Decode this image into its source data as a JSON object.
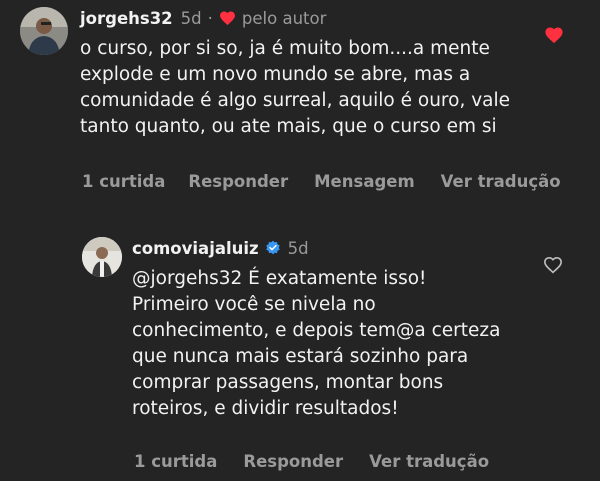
{
  "comment": {
    "username": "jorgehs32",
    "time": "5d",
    "liked_by_author": "pelo autor",
    "text": "o curso, por si so, ja é muito bom....a mente explode e um novo mundo se abre, mas a comunidade é algo surreal, aquilo é ouro, vale tanto quanto, ou ate mais, que o curso em si",
    "actions": {
      "likes": "1 curtida",
      "reply": "Responder",
      "message": "Mensagem",
      "translate": "Ver tradução"
    },
    "liked": true
  },
  "reply": {
    "username": "comoviajaluiz",
    "verified": true,
    "time": "5d",
    "text": "@jorgehs32 É exatamente isso! Primeiro você se nivela no conhecimento, e depois tem@a certeza que nunca mais estará sozinho para comprar passagens, montar bons roteiros, e dividir resultados!",
    "actions": {
      "likes": "1 curtida",
      "reply": "Responder",
      "translate": "Ver tradução"
    },
    "liked": false
  },
  "colors": {
    "background": "#242424",
    "heart": "#ff3040",
    "verified": "#3897f0",
    "muted": "#9a9a9a"
  }
}
